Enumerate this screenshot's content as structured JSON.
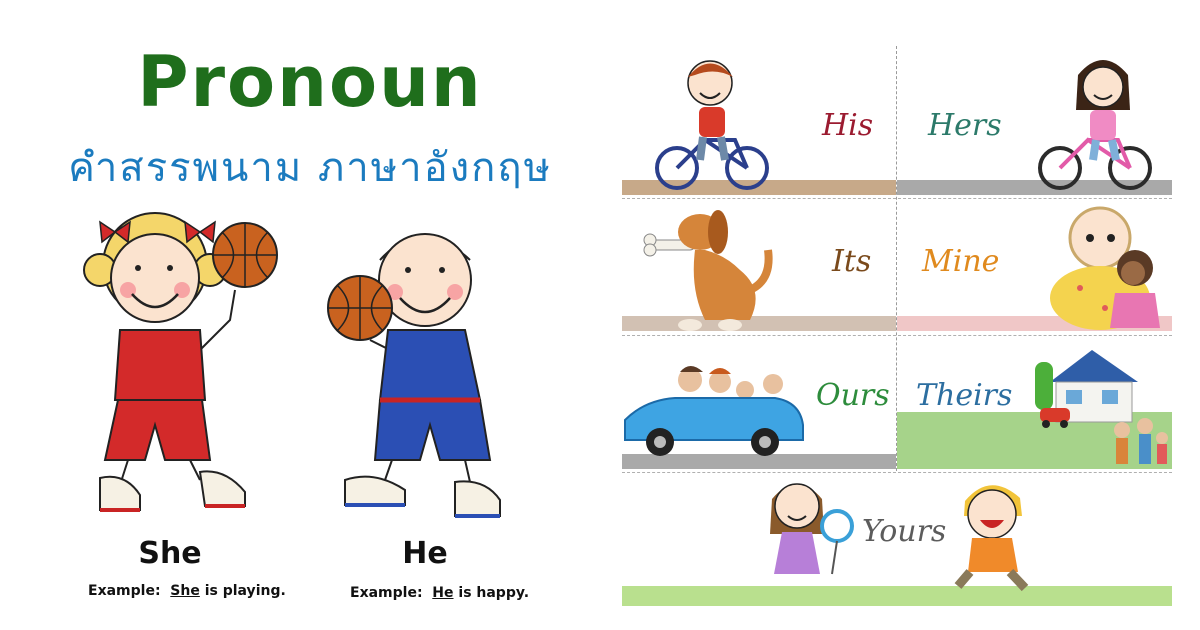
{
  "header": {
    "title": "Pronoun",
    "subtitle": "คำสรรพนาม ภาษาอังกฤษ"
  },
  "left_examples": [
    {
      "pronoun": "She",
      "example_prefix": "Example:",
      "example_subject": "She",
      "example_rest": "is playing."
    },
    {
      "pronoun": "He",
      "example_prefix": "Example:",
      "example_subject": "He",
      "example_rest": "is happy."
    }
  ],
  "cards": [
    {
      "word": "His"
    },
    {
      "word": "Hers"
    },
    {
      "word": "Its"
    },
    {
      "word": "Mine"
    },
    {
      "word": "Ours"
    },
    {
      "word": "Theirs"
    },
    {
      "word": "Yours"
    }
  ],
  "colors": {
    "title": "#1f6e1c",
    "subtitle": "#1b7bbf",
    "his": "#9b1b30",
    "hers": "#2c7a6a",
    "its": "#7a4a1c",
    "mine": "#e08a1e",
    "ours": "#2d8c3c",
    "theirs": "#2c6ea0",
    "yours": "#5c5c5c"
  }
}
